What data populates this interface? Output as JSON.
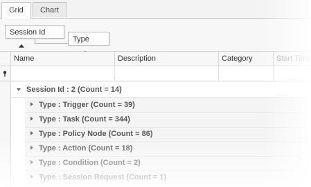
{
  "tabs": [
    {
      "label": "Grid",
      "active": true
    },
    {
      "label": "Chart",
      "active": false
    }
  ],
  "group_panel": {
    "chips": [
      {
        "label": "Session Id",
        "sort": "ascending"
      },
      {
        "label": "Type",
        "sort": "ascending"
      }
    ]
  },
  "columns": [
    "Name",
    "Description",
    "Category",
    "Start Time"
  ],
  "groups": [
    {
      "label": "Session Id : 2 (Count = 14)",
      "expanded": true,
      "level": 0
    },
    {
      "label": "Type : Trigger (Count = 39)",
      "expanded": false,
      "level": 1
    },
    {
      "label": "Type : Task (Count = 344)",
      "expanded": false,
      "level": 1
    },
    {
      "label": "Type : Policy Node (Count = 86)",
      "expanded": false,
      "level": 1
    },
    {
      "label": "Type : Action (Count = 18)",
      "expanded": false,
      "level": 1
    },
    {
      "label": "Type : Condition (Count = 2)",
      "expanded": false,
      "level": 1
    },
    {
      "label": "Type : Session Request (Count = 1)",
      "expanded": false,
      "level": 1
    }
  ],
  "colors": {
    "accent": "#f7f7f7",
    "group_text": "#555555",
    "border": "#d5d5d5"
  }
}
